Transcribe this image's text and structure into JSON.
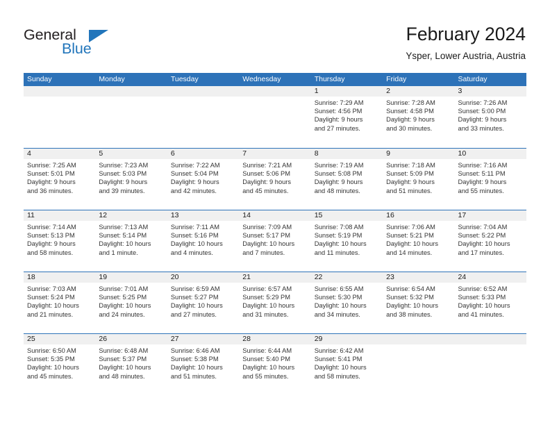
{
  "brand": {
    "name_part1": "General",
    "name_part2": "Blue",
    "triangle_icon": "triangle-logo-icon",
    "color_dark": "#231f20",
    "color_blue": "#2175bb"
  },
  "header": {
    "title": "February 2024",
    "subtitle": "Ysper, Lower Austria, Austria"
  },
  "theme": {
    "header_blue": "#2d72b8",
    "date_band_gray": "#f0f0f0",
    "text_dark": "#1a1a1a",
    "text_body": "#333333"
  },
  "weekdays": [
    "Sunday",
    "Monday",
    "Tuesday",
    "Wednesday",
    "Thursday",
    "Friday",
    "Saturday"
  ],
  "weeks": [
    [
      {
        "day": "",
        "sunrise": "",
        "sunset": "",
        "daylight_line1": "",
        "daylight_line2": ""
      },
      {
        "day": "",
        "sunrise": "",
        "sunset": "",
        "daylight_line1": "",
        "daylight_line2": ""
      },
      {
        "day": "",
        "sunrise": "",
        "sunset": "",
        "daylight_line1": "",
        "daylight_line2": ""
      },
      {
        "day": "",
        "sunrise": "",
        "sunset": "",
        "daylight_line1": "",
        "daylight_line2": ""
      },
      {
        "day": "1",
        "sunrise": "Sunrise: 7:29 AM",
        "sunset": "Sunset: 4:56 PM",
        "daylight_line1": "Daylight: 9 hours",
        "daylight_line2": "and 27 minutes."
      },
      {
        "day": "2",
        "sunrise": "Sunrise: 7:28 AM",
        "sunset": "Sunset: 4:58 PM",
        "daylight_line1": "Daylight: 9 hours",
        "daylight_line2": "and 30 minutes."
      },
      {
        "day": "3",
        "sunrise": "Sunrise: 7:26 AM",
        "sunset": "Sunset: 5:00 PM",
        "daylight_line1": "Daylight: 9 hours",
        "daylight_line2": "and 33 minutes."
      }
    ],
    [
      {
        "day": "4",
        "sunrise": "Sunrise: 7:25 AM",
        "sunset": "Sunset: 5:01 PM",
        "daylight_line1": "Daylight: 9 hours",
        "daylight_line2": "and 36 minutes."
      },
      {
        "day": "5",
        "sunrise": "Sunrise: 7:23 AM",
        "sunset": "Sunset: 5:03 PM",
        "daylight_line1": "Daylight: 9 hours",
        "daylight_line2": "and 39 minutes."
      },
      {
        "day": "6",
        "sunrise": "Sunrise: 7:22 AM",
        "sunset": "Sunset: 5:04 PM",
        "daylight_line1": "Daylight: 9 hours",
        "daylight_line2": "and 42 minutes."
      },
      {
        "day": "7",
        "sunrise": "Sunrise: 7:21 AM",
        "sunset": "Sunset: 5:06 PM",
        "daylight_line1": "Daylight: 9 hours",
        "daylight_line2": "and 45 minutes."
      },
      {
        "day": "8",
        "sunrise": "Sunrise: 7:19 AM",
        "sunset": "Sunset: 5:08 PM",
        "daylight_line1": "Daylight: 9 hours",
        "daylight_line2": "and 48 minutes."
      },
      {
        "day": "9",
        "sunrise": "Sunrise: 7:18 AM",
        "sunset": "Sunset: 5:09 PM",
        "daylight_line1": "Daylight: 9 hours",
        "daylight_line2": "and 51 minutes."
      },
      {
        "day": "10",
        "sunrise": "Sunrise: 7:16 AM",
        "sunset": "Sunset: 5:11 PM",
        "daylight_line1": "Daylight: 9 hours",
        "daylight_line2": "and 55 minutes."
      }
    ],
    [
      {
        "day": "11",
        "sunrise": "Sunrise: 7:14 AM",
        "sunset": "Sunset: 5:13 PM",
        "daylight_line1": "Daylight: 9 hours",
        "daylight_line2": "and 58 minutes."
      },
      {
        "day": "12",
        "sunrise": "Sunrise: 7:13 AM",
        "sunset": "Sunset: 5:14 PM",
        "daylight_line1": "Daylight: 10 hours",
        "daylight_line2": "and 1 minute."
      },
      {
        "day": "13",
        "sunrise": "Sunrise: 7:11 AM",
        "sunset": "Sunset: 5:16 PM",
        "daylight_line1": "Daylight: 10 hours",
        "daylight_line2": "and 4 minutes."
      },
      {
        "day": "14",
        "sunrise": "Sunrise: 7:09 AM",
        "sunset": "Sunset: 5:17 PM",
        "daylight_line1": "Daylight: 10 hours",
        "daylight_line2": "and 7 minutes."
      },
      {
        "day": "15",
        "sunrise": "Sunrise: 7:08 AM",
        "sunset": "Sunset: 5:19 PM",
        "daylight_line1": "Daylight: 10 hours",
        "daylight_line2": "and 11 minutes."
      },
      {
        "day": "16",
        "sunrise": "Sunrise: 7:06 AM",
        "sunset": "Sunset: 5:21 PM",
        "daylight_line1": "Daylight: 10 hours",
        "daylight_line2": "and 14 minutes."
      },
      {
        "day": "17",
        "sunrise": "Sunrise: 7:04 AM",
        "sunset": "Sunset: 5:22 PM",
        "daylight_line1": "Daylight: 10 hours",
        "daylight_line2": "and 17 minutes."
      }
    ],
    [
      {
        "day": "18",
        "sunrise": "Sunrise: 7:03 AM",
        "sunset": "Sunset: 5:24 PM",
        "daylight_line1": "Daylight: 10 hours",
        "daylight_line2": "and 21 minutes."
      },
      {
        "day": "19",
        "sunrise": "Sunrise: 7:01 AM",
        "sunset": "Sunset: 5:25 PM",
        "daylight_line1": "Daylight: 10 hours",
        "daylight_line2": "and 24 minutes."
      },
      {
        "day": "20",
        "sunrise": "Sunrise: 6:59 AM",
        "sunset": "Sunset: 5:27 PM",
        "daylight_line1": "Daylight: 10 hours",
        "daylight_line2": "and 27 minutes."
      },
      {
        "day": "21",
        "sunrise": "Sunrise: 6:57 AM",
        "sunset": "Sunset: 5:29 PM",
        "daylight_line1": "Daylight: 10 hours",
        "daylight_line2": "and 31 minutes."
      },
      {
        "day": "22",
        "sunrise": "Sunrise: 6:55 AM",
        "sunset": "Sunset: 5:30 PM",
        "daylight_line1": "Daylight: 10 hours",
        "daylight_line2": "and 34 minutes."
      },
      {
        "day": "23",
        "sunrise": "Sunrise: 6:54 AM",
        "sunset": "Sunset: 5:32 PM",
        "daylight_line1": "Daylight: 10 hours",
        "daylight_line2": "and 38 minutes."
      },
      {
        "day": "24",
        "sunrise": "Sunrise: 6:52 AM",
        "sunset": "Sunset: 5:33 PM",
        "daylight_line1": "Daylight: 10 hours",
        "daylight_line2": "and 41 minutes."
      }
    ],
    [
      {
        "day": "25",
        "sunrise": "Sunrise: 6:50 AM",
        "sunset": "Sunset: 5:35 PM",
        "daylight_line1": "Daylight: 10 hours",
        "daylight_line2": "and 45 minutes."
      },
      {
        "day": "26",
        "sunrise": "Sunrise: 6:48 AM",
        "sunset": "Sunset: 5:37 PM",
        "daylight_line1": "Daylight: 10 hours",
        "daylight_line2": "and 48 minutes."
      },
      {
        "day": "27",
        "sunrise": "Sunrise: 6:46 AM",
        "sunset": "Sunset: 5:38 PM",
        "daylight_line1": "Daylight: 10 hours",
        "daylight_line2": "and 51 minutes."
      },
      {
        "day": "28",
        "sunrise": "Sunrise: 6:44 AM",
        "sunset": "Sunset: 5:40 PM",
        "daylight_line1": "Daylight: 10 hours",
        "daylight_line2": "and 55 minutes."
      },
      {
        "day": "29",
        "sunrise": "Sunrise: 6:42 AM",
        "sunset": "Sunset: 5:41 PM",
        "daylight_line1": "Daylight: 10 hours",
        "daylight_line2": "and 58 minutes."
      },
      {
        "day": "",
        "sunrise": "",
        "sunset": "",
        "daylight_line1": "",
        "daylight_line2": ""
      },
      {
        "day": "",
        "sunrise": "",
        "sunset": "",
        "daylight_line1": "",
        "daylight_line2": ""
      }
    ]
  ]
}
